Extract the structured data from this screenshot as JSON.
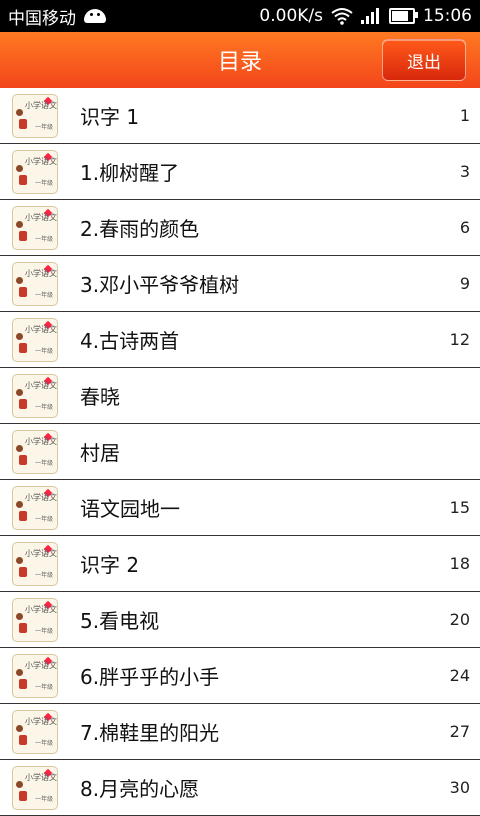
{
  "status_bar": {
    "carrier": "中国移动",
    "speed": "0.00K/s",
    "time": "15:06"
  },
  "header": {
    "title": "目录",
    "exit_label": "退出"
  },
  "thumbnail": {
    "top_text": "小学语文",
    "bottom_text": "一年级"
  },
  "items": [
    {
      "title": "识字 1",
      "page": "1"
    },
    {
      "title": "1.柳树醒了",
      "page": "3"
    },
    {
      "title": "2.春雨的颜色",
      "page": "6"
    },
    {
      "title": "3.邓小平爷爷植树",
      "page": "9"
    },
    {
      "title": "4.古诗两首",
      "page": "12"
    },
    {
      "title": "春晓",
      "page": ""
    },
    {
      "title": "村居",
      "page": ""
    },
    {
      "title": "语文园地一",
      "page": "15"
    },
    {
      "title": "识字 2",
      "page": "18"
    },
    {
      "title": "5.看电视",
      "page": "20"
    },
    {
      "title": "6.胖乎乎的小手",
      "page": "24"
    },
    {
      "title": "7.棉鞋里的阳光",
      "page": "27"
    },
    {
      "title": "8.月亮的心愿",
      "page": "30"
    }
  ]
}
